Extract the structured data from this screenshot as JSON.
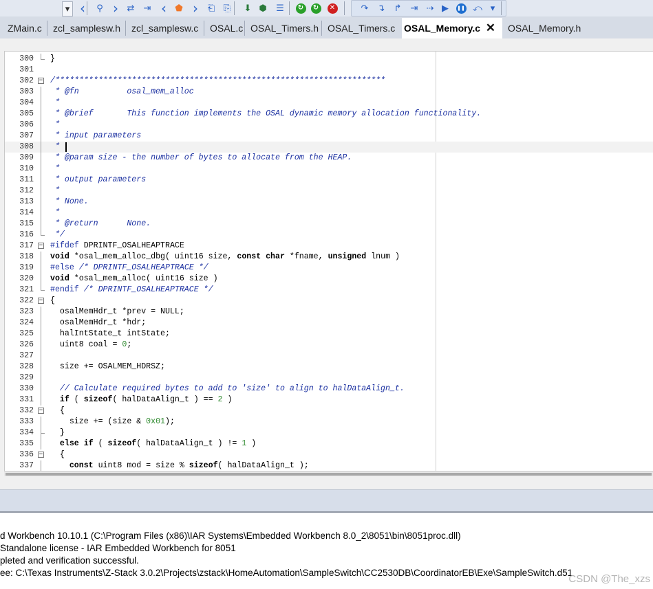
{
  "toolbar": {
    "buttons": [
      {
        "name": "dropdown-arrow-icon",
        "glyph": "▾"
      },
      {
        "name": "back-icon",
        "glyph": "‹"
      },
      {
        "name": "find-icon",
        "glyph": "⚲"
      },
      {
        "name": "forward-icon",
        "glyph": "›"
      },
      {
        "name": "swap-icon",
        "glyph": "⇄"
      },
      {
        "name": "indent-icon",
        "glyph": "⇥"
      },
      {
        "name": "prev-bookmark-icon",
        "glyph": "‹"
      },
      {
        "name": "shield-bookmark-icon",
        "glyph": "⬟"
      },
      {
        "name": "next-bookmark-icon",
        "glyph": "›"
      },
      {
        "name": "file-back-icon",
        "glyph": "⎗"
      },
      {
        "name": "file-forward-icon",
        "glyph": "⎘"
      },
      {
        "name": "download-icon",
        "glyph": "⬇"
      },
      {
        "name": "make-icon",
        "glyph": "⬢"
      },
      {
        "name": "list-icon",
        "glyph": "☰"
      },
      {
        "name": "rebuild-icon",
        "glyph": "↻"
      },
      {
        "name": "refresh-icon",
        "glyph": "↻"
      },
      {
        "name": "stop-icon",
        "glyph": "✕"
      },
      {
        "name": "step-over-icon",
        "glyph": "↷"
      },
      {
        "name": "step-into-icon",
        "glyph": "↴"
      },
      {
        "name": "step-out-icon",
        "glyph": "↱"
      },
      {
        "name": "next-statement-icon",
        "glyph": "⇥"
      },
      {
        "name": "run-to-cursor-icon",
        "glyph": "⇢"
      },
      {
        "name": "go-icon",
        "glyph": "▶"
      },
      {
        "name": "break-icon",
        "glyph": "❚❚"
      },
      {
        "name": "reset-icon",
        "glyph": "⤺"
      },
      {
        "name": "more-icon",
        "glyph": "▾"
      }
    ]
  },
  "tabs": [
    {
      "label": "ZMain.c",
      "active": false
    },
    {
      "label": "zcl_samplesw.h",
      "active": false
    },
    {
      "label": "zcl_samplesw.c",
      "active": false
    },
    {
      "label": "OSAL.c",
      "active": false
    },
    {
      "label": "OSAL_Timers.h",
      "active": false
    },
    {
      "label": "OSAL_Timers.c",
      "active": false
    },
    {
      "label": "OSAL_Memory.c",
      "active": true,
      "close": "✕"
    },
    {
      "label": "OSAL_Memory.h",
      "active": false
    }
  ],
  "editor": {
    "current_line": 308,
    "lines": [
      {
        "n": "300",
        "fold": "end",
        "parts": [
          [
            "p",
            "}"
          ]
        ]
      },
      {
        "n": "301",
        "fold": "",
        "parts": []
      },
      {
        "n": "302",
        "fold": "open",
        "parts": [
          [
            "c",
            "/*********************************************************************"
          ]
        ]
      },
      {
        "n": "303",
        "fold": "bar",
        "parts": [
          [
            "c",
            " * @fn          osal_mem_alloc"
          ]
        ]
      },
      {
        "n": "304",
        "fold": "bar",
        "parts": [
          [
            "c",
            " *"
          ]
        ]
      },
      {
        "n": "305",
        "fold": "bar",
        "parts": [
          [
            "c",
            " * @brief       This function implements the OSAL dynamic memory allocation functionality."
          ]
        ]
      },
      {
        "n": "306",
        "fold": "bar",
        "parts": [
          [
            "c",
            " *"
          ]
        ]
      },
      {
        "n": "307",
        "fold": "bar",
        "parts": [
          [
            "c",
            " * input parameters"
          ]
        ]
      },
      {
        "n": "308",
        "fold": "bar",
        "parts": [
          [
            "c",
            " *"
          ]
        ]
      },
      {
        "n": "309",
        "fold": "bar",
        "parts": [
          [
            "c",
            " * @param size - the number of bytes to allocate from the HEAP."
          ]
        ]
      },
      {
        "n": "310",
        "fold": "bar",
        "parts": [
          [
            "c",
            " *"
          ]
        ]
      },
      {
        "n": "311",
        "fold": "bar",
        "parts": [
          [
            "c",
            " * output parameters"
          ]
        ]
      },
      {
        "n": "312",
        "fold": "bar",
        "parts": [
          [
            "c",
            " *"
          ]
        ]
      },
      {
        "n": "313",
        "fold": "bar",
        "parts": [
          [
            "c",
            " * None."
          ]
        ]
      },
      {
        "n": "314",
        "fold": "bar",
        "parts": [
          [
            "c",
            " *"
          ]
        ]
      },
      {
        "n": "315",
        "fold": "bar",
        "parts": [
          [
            "c",
            " * @return      None."
          ]
        ]
      },
      {
        "n": "316",
        "fold": "end",
        "parts": [
          [
            "c",
            " */"
          ]
        ]
      },
      {
        "n": "317",
        "fold": "open",
        "parts": [
          [
            "pp",
            "#ifdef"
          ],
          [
            "p",
            " DPRINTF_OSALHEAPTRACE"
          ]
        ]
      },
      {
        "n": "318",
        "fold": "bar",
        "parts": [
          [
            "k",
            "void"
          ],
          [
            "p",
            " *osal_mem_alloc_dbg( uint16 size, "
          ],
          [
            "k",
            "const char"
          ],
          [
            "p",
            " *fname, "
          ],
          [
            "k",
            "unsigned"
          ],
          [
            "p",
            " lnum )"
          ]
        ]
      },
      {
        "n": "319",
        "fold": "bar",
        "parts": [
          [
            "pp",
            "#else"
          ],
          [
            "c",
            " /* DPRINTF_OSALHEAPTRACE */"
          ]
        ]
      },
      {
        "n": "320",
        "fold": "bar",
        "parts": [
          [
            "k",
            "void"
          ],
          [
            "p",
            " *osal_mem_alloc( uint16 size )"
          ]
        ]
      },
      {
        "n": "321",
        "fold": "end",
        "parts": [
          [
            "pp",
            "#endif"
          ],
          [
            "c",
            " /* DPRINTF_OSALHEAPTRACE */"
          ]
        ]
      },
      {
        "n": "322",
        "fold": "open",
        "parts": [
          [
            "p",
            "{"
          ]
        ]
      },
      {
        "n": "323",
        "fold": "bar",
        "parts": [
          [
            "p",
            "  osalMemHdr_t *prev = NULL;"
          ]
        ]
      },
      {
        "n": "324",
        "fold": "bar",
        "parts": [
          [
            "p",
            "  osalMemHdr_t *hdr;"
          ]
        ]
      },
      {
        "n": "325",
        "fold": "bar",
        "parts": [
          [
            "p",
            "  halIntState_t intState;"
          ]
        ]
      },
      {
        "n": "326",
        "fold": "bar",
        "parts": [
          [
            "p",
            "  uint8 coal = "
          ],
          [
            "n",
            "0"
          ],
          [
            "p",
            ";"
          ]
        ]
      },
      {
        "n": "327",
        "fold": "bar",
        "parts": []
      },
      {
        "n": "328",
        "fold": "bar",
        "parts": [
          [
            "p",
            "  size += OSALMEM_HDRSZ;"
          ]
        ]
      },
      {
        "n": "329",
        "fold": "bar",
        "parts": []
      },
      {
        "n": "330",
        "fold": "bar",
        "parts": [
          [
            "c",
            "  // Calculate required bytes to add to 'size' to align to halDataAlign_t."
          ]
        ]
      },
      {
        "n": "331",
        "fold": "bar",
        "parts": [
          [
            "p",
            "  "
          ],
          [
            "k",
            "if"
          ],
          [
            "p",
            " ( "
          ],
          [
            "k",
            "sizeof"
          ],
          [
            "p",
            "( halDataAlign_t ) == "
          ],
          [
            "n",
            "2"
          ],
          [
            "p",
            " )"
          ]
        ]
      },
      {
        "n": "332",
        "fold": "open",
        "parts": [
          [
            "p",
            "  {"
          ]
        ]
      },
      {
        "n": "333",
        "fold": "bar",
        "parts": [
          [
            "p",
            "    size += (size & "
          ],
          [
            "n",
            "0x01"
          ],
          [
            "p",
            ");"
          ]
        ]
      },
      {
        "n": "334",
        "fold": "endmid",
        "parts": [
          [
            "p",
            "  }"
          ]
        ]
      },
      {
        "n": "335",
        "fold": "bar",
        "parts": [
          [
            "p",
            "  "
          ],
          [
            "k",
            "else if"
          ],
          [
            "p",
            " ( "
          ],
          [
            "k",
            "sizeof"
          ],
          [
            "p",
            "( halDataAlign_t ) != "
          ],
          [
            "n",
            "1"
          ],
          [
            "p",
            " )"
          ]
        ]
      },
      {
        "n": "336",
        "fold": "open",
        "parts": [
          [
            "p",
            "  {"
          ]
        ]
      },
      {
        "n": "337",
        "fold": "bar",
        "parts": [
          [
            "p",
            "    "
          ],
          [
            "k",
            "const"
          ],
          [
            "p",
            " uint8 mod = size % "
          ],
          [
            "k",
            "sizeof"
          ],
          [
            "p",
            "( halDataAlign_t );"
          ]
        ]
      }
    ]
  },
  "output": {
    "lines": [
      "d Workbench 10.10.1 (C:\\Program Files (x86)\\IAR Systems\\Embedded Workbench 8.0_2\\8051\\bin\\8051proc.dll)",
      "Standalone license - IAR Embedded Workbench for 8051",
      "pleted and verification successful.",
      "ee: C:\\Texas Instruments\\Z-Stack 3.0.2\\Projects\\zstack\\HomeAutomation\\SampleSwitch\\CC2530DB\\CoordinatorEB\\Exe\\SampleSwitch.d51"
    ]
  },
  "watermark": "CSDN @The_xzs",
  "colors": {
    "comment": "#1a2fa0",
    "number": "#2f8a2f",
    "keyword": "#000000",
    "tab_bar": "#d6dce6",
    "toolbar": "#e3e8f1"
  }
}
